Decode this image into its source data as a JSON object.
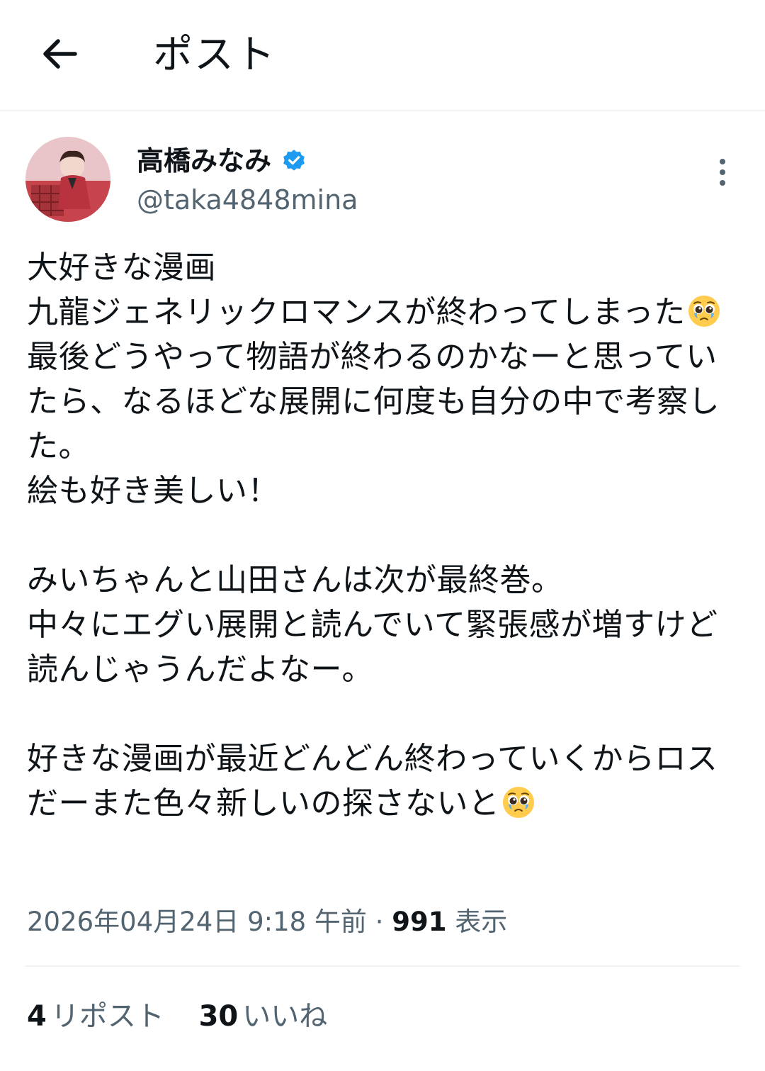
{
  "header": {
    "title": "ポスト",
    "back_icon": "arrow-left-icon"
  },
  "author": {
    "display_name": "高橋みなみ",
    "handle": "@taka4848mina",
    "verified": true,
    "verified_color": "#1d9bf0"
  },
  "post": {
    "para1_line1": "大好きな漫画",
    "para1_line2_a": "九龍ジェネリックロマンスが終わってしまった",
    "para1_line2_b": "最後どうやって物語が終わるのかなーと思っていたら、なるほどな展開に何度も自分の中で考察した。",
    "para1_line3": "絵も好き美しい！",
    "para2_line1": "みいちゃんと山田さんは次が最終巻。",
    "para2_line2": "中々にエグい展開と読んでいて緊張感が増すけど読んじゃうんだよなー。",
    "para3_text": "好きな漫画が最近どんどん終わっていくからロスだーまた色々新しいの探さないと",
    "emoji": "pleading-face"
  },
  "meta": {
    "timestamp": "2026年04月24日 9:18 午前",
    "separator": " · ",
    "views_count": "991",
    "views_label": "表示"
  },
  "stats": {
    "reposts_count": "4",
    "reposts_label": "リポスト",
    "likes_count": "30",
    "likes_label": "いいね"
  },
  "colors": {
    "text": "#0f1419",
    "secondary": "#536471",
    "divider": "#eff3f4"
  }
}
